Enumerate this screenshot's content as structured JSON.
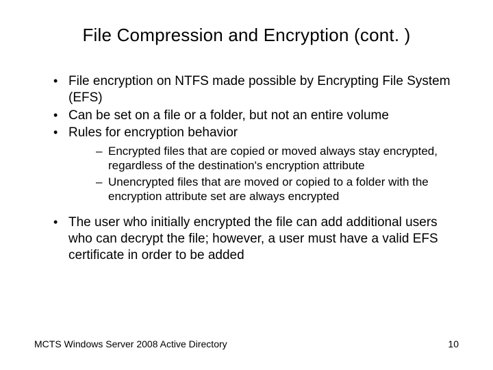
{
  "title": "File Compression and Encryption (cont. )",
  "bullets": {
    "b1": "File encryption on NTFS made possible by Encrypting File System (EFS)",
    "b2": "Can be set on a file or a folder, but not an entire volume",
    "b3": "Rules for encryption behavior",
    "b3_sub1": "Encrypted files that are copied or moved always stay encrypted, regardless of the destination's encryption attribute",
    "b3_sub2": "Unencrypted files that are moved or copied to a folder with the encryption attribute set are always encrypted",
    "b4": "The user who initially encrypted the file can add additional users who can decrypt the file; however, a user must have a valid EFS certificate in order to be added"
  },
  "footer": {
    "left": "MCTS Windows Server 2008 Active Directory",
    "right": "10"
  }
}
